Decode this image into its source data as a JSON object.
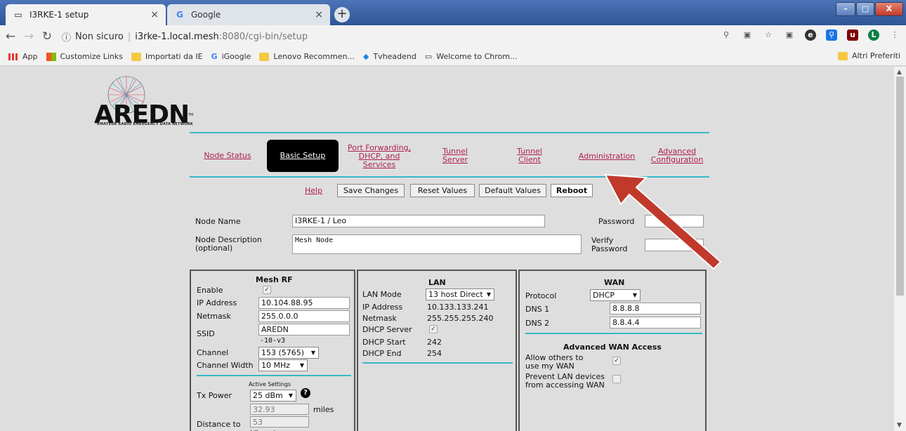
{
  "browser": {
    "tabs": [
      {
        "title": "I3RKE-1 setup",
        "active": true
      },
      {
        "title": "Google",
        "active": false
      }
    ],
    "address": {
      "security": "Non sicuro",
      "host": "i3rke-1.local.mesh",
      "path": ":8080/cgi-bin/setup"
    },
    "bookmarks": [
      {
        "label": "App",
        "icon": "apps-grid-icon"
      },
      {
        "label": "Customize Links",
        "icon": "windows-logo-icon"
      },
      {
        "label": "Importati da IE",
        "icon": "folder-icon"
      },
      {
        "label": "iGoogle",
        "icon": "google-icon"
      },
      {
        "label": "Lenovo Recommen...",
        "icon": "folder-icon"
      },
      {
        "label": "Tvheadend",
        "icon": "tvheadend-icon"
      },
      {
        "label": "Welcome to Chrom...",
        "icon": "page-icon"
      }
    ],
    "other_bookmarks": "Altri Preferiti",
    "profile_initial": "L"
  },
  "page": {
    "logo": {
      "text": "AREDN",
      "subtitle": "AMATEUR RADIO EMERGENCY DATA NETWORK",
      "tm": "TM"
    },
    "nav": [
      {
        "label": "Node Status"
      },
      {
        "label": "Basic Setup",
        "active": true
      },
      {
        "label": "Port Forwarding, DHCP, and Services"
      },
      {
        "label": "Tunnel Server"
      },
      {
        "label": "Tunnel Client"
      },
      {
        "label": "Administration"
      },
      {
        "label": "Advanced Configuration"
      }
    ],
    "actions": {
      "help": "Help",
      "save": "Save Changes",
      "reset": "Reset Values",
      "default": "Default Values",
      "reboot": "Reboot"
    },
    "node": {
      "name_label": "Node Name",
      "name_value": "I3RKE-1 / Leo",
      "desc_label": "Node Description (optional)",
      "desc_value": "Mesh Node",
      "password_label": "Password",
      "verify_label": "Verify Password"
    },
    "mesh_rf": {
      "title": "Mesh RF",
      "enable_label": "Enable",
      "enable_checked": true,
      "ip_label": "IP Address",
      "ip_value": "10.104.88.95",
      "netmask_label": "Netmask",
      "netmask_value": "255.0.0.0",
      "ssid_label": "SSID",
      "ssid_value": "AREDN",
      "ssid_suffix": "-10-v3",
      "channel_label": "Channel",
      "channel_value": "153 (5765)",
      "width_label": "Channel Width",
      "width_value": "10 MHz",
      "active_settings": "Active Settings",
      "txpower_label": "Tx Power",
      "txpower_value": "25 dBm",
      "distance_miles": "32.93",
      "miles_unit": "miles",
      "distance_km": "53",
      "km_unit": "kilometers",
      "distance_label": "Distance to"
    },
    "lan": {
      "title": "LAN",
      "mode_label": "LAN Mode",
      "mode_value": "13 host Direct",
      "ip_label": "IP Address",
      "ip_value": "10.133.133.241",
      "netmask_label": "Netmask",
      "netmask_value": "255.255.255.240",
      "dhcp_label": "DHCP Server",
      "dhcp_checked": true,
      "start_label": "DHCP Start",
      "start_value": "242",
      "end_label": "DHCP End",
      "end_value": "254"
    },
    "wan": {
      "title": "WAN",
      "protocol_label": "Protocol",
      "protocol_value": "DHCP",
      "dns1_label": "DNS 1",
      "dns1_value": "8.8.8.8",
      "dns2_label": "DNS 2",
      "dns2_value": "8.8.4.4",
      "adv_title": "Advanced WAN Access",
      "allow_label": "Allow others to use my WAN",
      "allow_checked": true,
      "prevent_label": "Prevent LAN devices from accessing WAN",
      "prevent_checked": false
    }
  },
  "colors": {
    "accent": "#37b8c8",
    "link": "#b0214e",
    "arrow": "#c0392b",
    "chrome": "#2e5596"
  }
}
